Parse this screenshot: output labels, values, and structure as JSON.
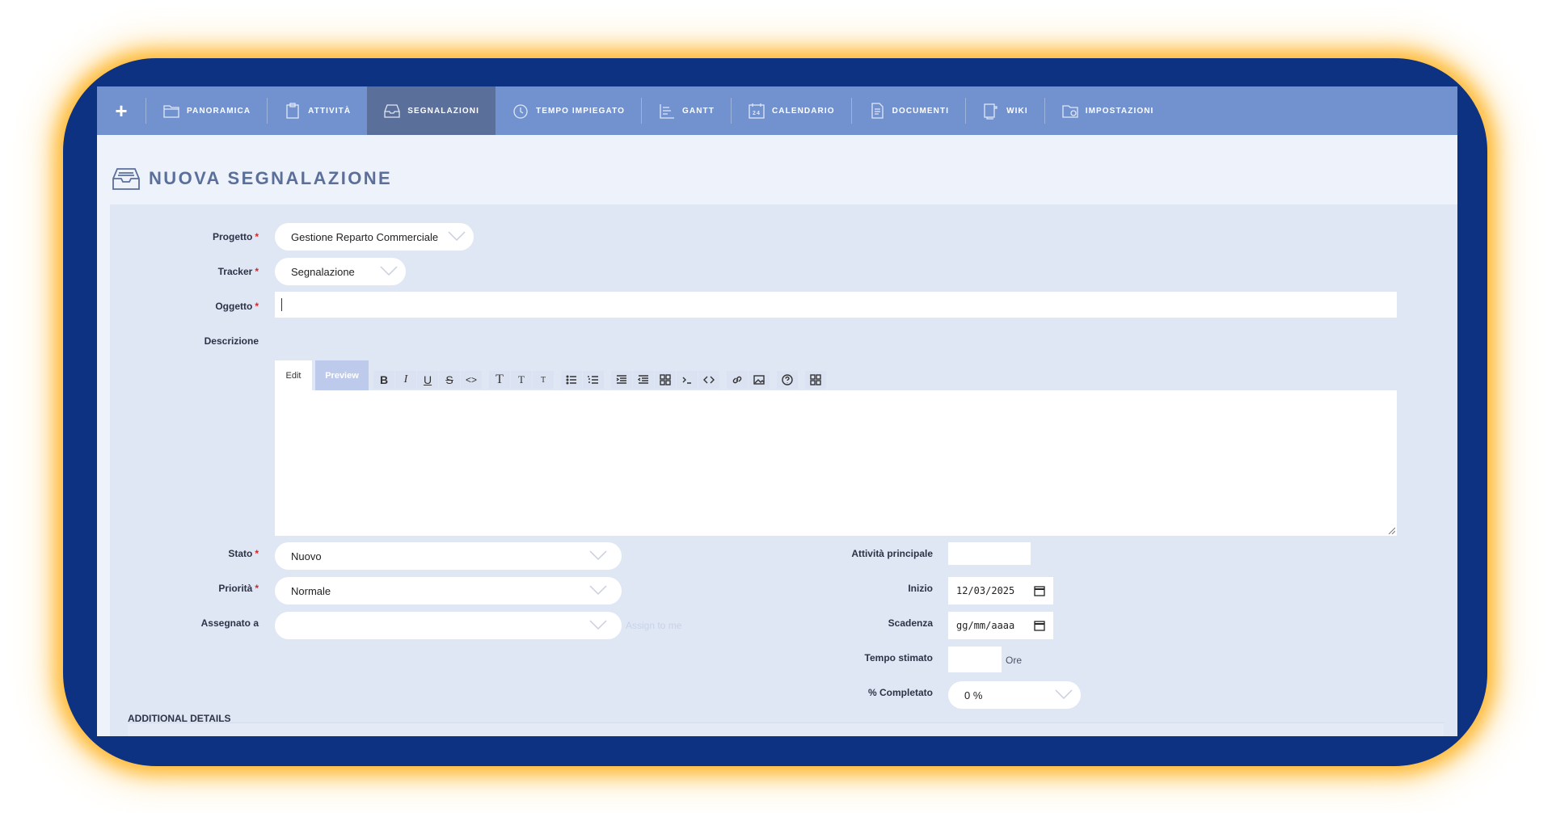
{
  "nav": {
    "plus": "+",
    "items": [
      {
        "label": "PANORAMICA",
        "icon": "folder-icon"
      },
      {
        "label": "ATTIVITÀ",
        "icon": "clipboard-icon"
      },
      {
        "label": "SEGNALAZIONI",
        "icon": "inbox-icon",
        "active": true
      },
      {
        "label": "TEMPO IMPIEGATO",
        "icon": "clock-icon"
      },
      {
        "label": "GANTT",
        "icon": "gantt-icon"
      },
      {
        "label": "CALENDARIO",
        "icon": "calendar-icon",
        "badge": "24"
      },
      {
        "label": "DOCUMENTI",
        "icon": "document-icon"
      },
      {
        "label": "WIKI",
        "icon": "wiki-icon"
      },
      {
        "label": "IMPOSTAZIONI",
        "icon": "folder-settings-icon"
      }
    ]
  },
  "page": {
    "title": "NUOVA SEGNALAZIONE"
  },
  "form": {
    "progetto": {
      "label": "Progetto",
      "value": "Gestione Reparto Commerciale"
    },
    "tracker": {
      "label": "Tracker",
      "value": "Segnalazione"
    },
    "oggetto": {
      "label": "Oggetto",
      "value": ""
    },
    "descrizione": {
      "label": "Descrizione",
      "tab_edit": "Edit",
      "tab_preview": "Preview",
      "toolbar": [
        "B",
        "I",
        "U",
        "S",
        "<>",
        "T",
        "T",
        "T"
      ]
    },
    "stato": {
      "label": "Stato",
      "value": "Nuovo"
    },
    "priorita": {
      "label": "Priorità",
      "value": "Normale"
    },
    "assegnato": {
      "label": "Assegnato a",
      "value": "",
      "assign_to_me": "Assign to me"
    },
    "attivita_principale": {
      "label": "Attività principale",
      "value": ""
    },
    "inizio": {
      "label": "Inizio",
      "value": "12/03/2025"
    },
    "scadenza": {
      "label": "Scadenza",
      "value": "gg/mm/aaaa"
    },
    "tempo_stimato": {
      "label": "Tempo stimato",
      "value": "",
      "unit": "Ore"
    },
    "completato": {
      "label": "% Completato",
      "value": "0 %"
    },
    "additional_details": "ADDITIONAL DETAILS"
  },
  "colors": {
    "frame": "#0d3281",
    "glow": "#ffb01e",
    "navbar": "#7292cf",
    "nav_active": "#5b6f9b",
    "required": "#d0282f"
  }
}
